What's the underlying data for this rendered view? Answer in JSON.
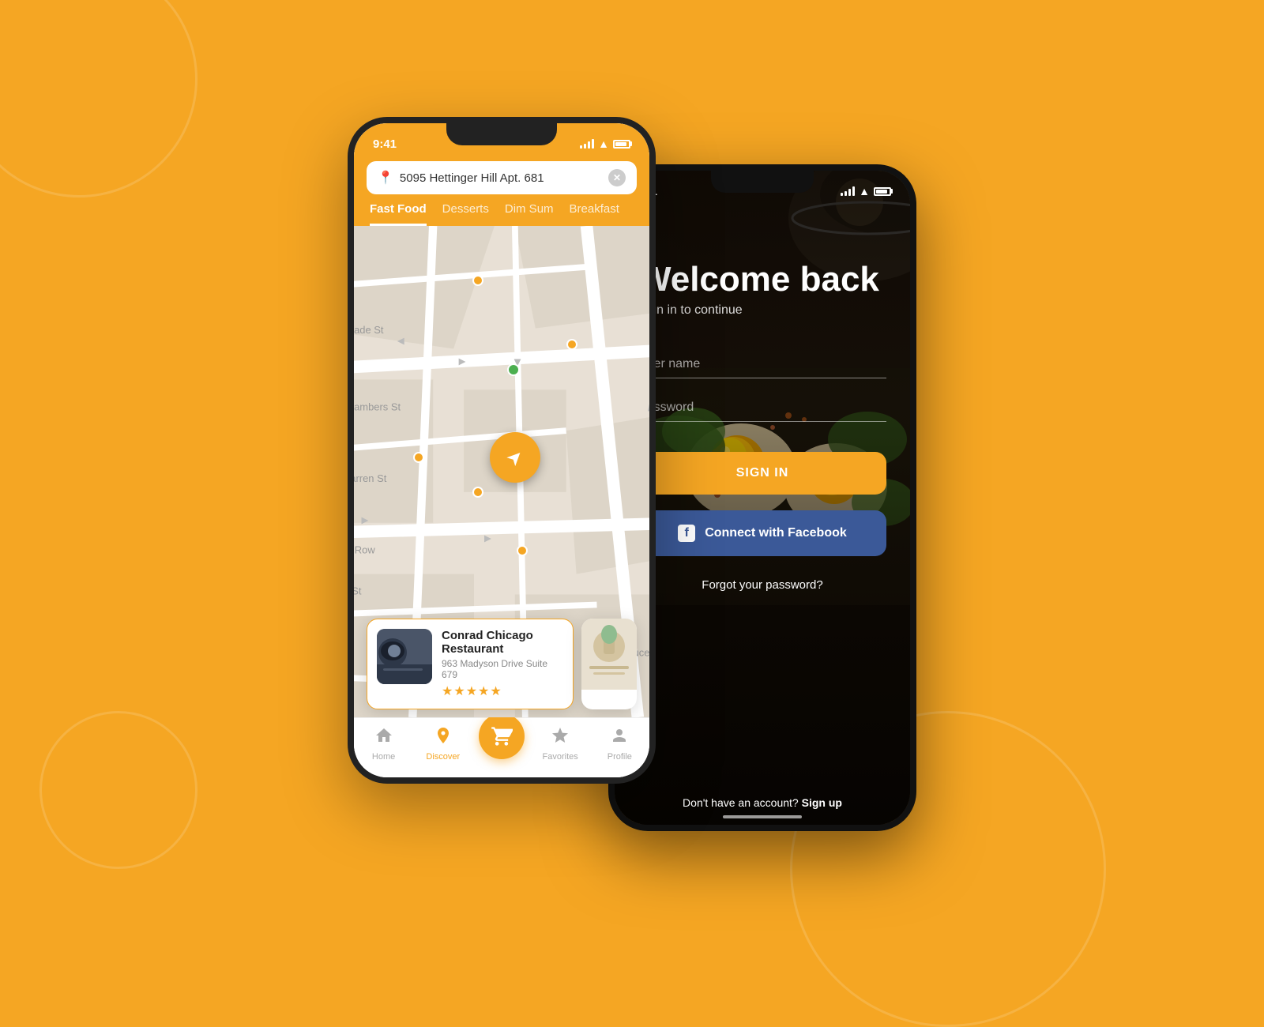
{
  "background": {
    "color": "#F5A623"
  },
  "phone1": {
    "status_bar": {
      "time": "9:41",
      "signal": "signal",
      "wifi": "wifi",
      "battery": "battery"
    },
    "search": {
      "placeholder": "5095 Hettinger Hill Apt. 681",
      "value": "5095 Hettinger Hill Apt. 681"
    },
    "categories": [
      {
        "label": "Fast Food",
        "active": true
      },
      {
        "label": "Desserts",
        "active": false
      },
      {
        "label": "Dim Sum",
        "active": false
      },
      {
        "label": "Breakfast",
        "active": false
      }
    ],
    "restaurant_card": {
      "name": "Conrad Chicago Restaurant",
      "address": "963 Madyson Drive Suite 679",
      "stars": "★★★★★",
      "rating": 5
    },
    "bottom_nav": [
      {
        "icon": "🏠",
        "label": "Home",
        "active": false
      },
      {
        "icon": "📍",
        "label": "Discover",
        "active": true
      },
      {
        "icon": "🛒",
        "label": "Cart",
        "active": false,
        "is_cart": true
      },
      {
        "icon": "☆",
        "label": "Favorites",
        "active": false
      },
      {
        "icon": "👤",
        "label": "Profile",
        "active": false
      }
    ]
  },
  "phone2": {
    "status_bar": {
      "time": "9:41"
    },
    "welcome_title": "Welcome back",
    "welcome_subtitle": "Sign in to continue",
    "form": {
      "username_placeholder": "User name",
      "password_placeholder": "Password"
    },
    "signin_button": "SIGN IN",
    "facebook_button": "Connect with Facebook",
    "forgot_password": "Forgot your password?",
    "signup_text": "Don't have an account?",
    "signup_link": "Sign up"
  }
}
